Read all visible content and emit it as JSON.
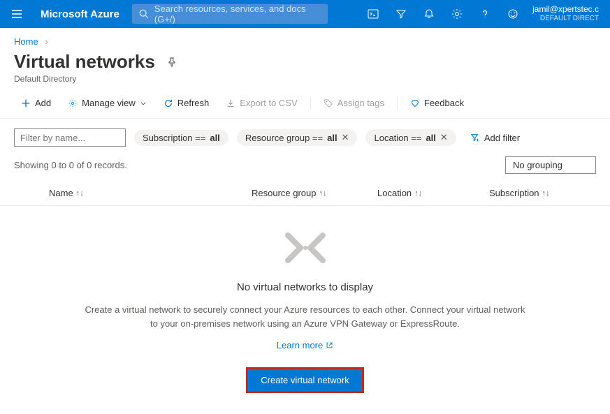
{
  "topbar": {
    "brand": "Microsoft Azure",
    "search_placeholder": "Search resources, services, and docs (G+/)",
    "account_email": "jamil@xpertstec.c",
    "account_directory": "DEFAULT DIRECT"
  },
  "breadcrumb": {
    "items": [
      "Home"
    ]
  },
  "page": {
    "title": "Virtual networks",
    "subtitle": "Default Directory"
  },
  "toolbar": {
    "add": "Add",
    "manage_view": "Manage view",
    "refresh": "Refresh",
    "export_csv": "Export to CSV",
    "assign_tags": "Assign tags",
    "feedback": "Feedback"
  },
  "filters": {
    "name_placeholder": "Filter by name...",
    "pills": [
      {
        "label": "Subscription == ",
        "value": "all",
        "removable": false
      },
      {
        "label": "Resource group == ",
        "value": "all",
        "removable": true
      },
      {
        "label": "Location == ",
        "value": "all",
        "removable": true
      }
    ],
    "add_filter": "Add filter"
  },
  "status": {
    "records": "Showing 0 to 0 of 0 records.",
    "grouping": "No grouping"
  },
  "columns": {
    "name": "Name",
    "resource_group": "Resource group",
    "location": "Location",
    "subscription": "Subscription"
  },
  "empty": {
    "title": "No virtual networks to display",
    "description": "Create a virtual network to securely connect your Azure resources to each other. Connect your virtual network to your on-premises network using an Azure VPN Gateway or ExpressRoute.",
    "learn_more": "Learn more",
    "create_button": "Create virtual network"
  }
}
